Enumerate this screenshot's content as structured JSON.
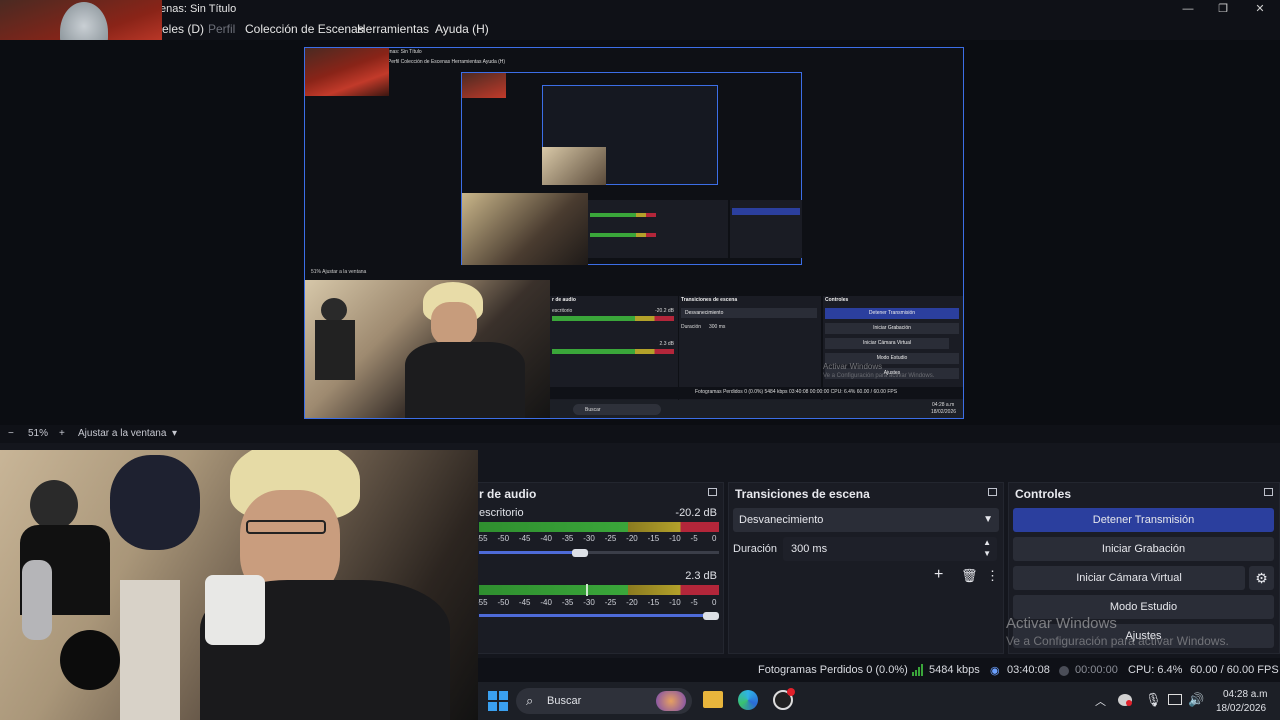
{
  "window": {
    "title": "enas: Sin Título",
    "minimize_glyph": "—",
    "maximize_glyph": "❐",
    "close_glyph": "✕"
  },
  "menu": [
    {
      "label": "eles (D)",
      "enabled": true
    },
    {
      "label": "Perfil",
      "enabled": false
    },
    {
      "label": "Colección de Escenas",
      "enabled": true
    },
    {
      "label": "Herramientas",
      "enabled": true
    },
    {
      "label": "Ayuda (H)",
      "enabled": true
    }
  ],
  "zoom": {
    "minus": "−",
    "value": "51%",
    "plus": "+",
    "fit_label": "Ajustar a la ventana",
    "dropdown_glyph": "▾"
  },
  "audio_mixer": {
    "title": "r de audio",
    "channels": [
      {
        "name": "escritorio",
        "db": "-20.2 dB",
        "volume": 0.5
      },
      {
        "name": "",
        "db": "2.3 dB",
        "volume": 1.0
      }
    ],
    "scale": [
      "-55",
      "-50",
      "-45",
      "-40",
      "-35",
      "-30",
      "-25",
      "-20",
      "-15",
      "-10",
      "-5",
      "0"
    ]
  },
  "transitions": {
    "title": "Transiciones de escena",
    "selected": "Desvanecimiento",
    "duration_label": "Duración",
    "duration_value": "300 ms",
    "add_glyph": "+",
    "delete_glyph": "🗑",
    "more_glyph": "⋮"
  },
  "controls": {
    "title": "Controles",
    "buttons": [
      {
        "label": "Detener Transmisión",
        "active": true
      },
      {
        "label": "Iniciar Grabación",
        "active": false
      },
      {
        "label": "Iniciar Cámara Virtual",
        "active": false
      },
      {
        "label": "Modo Estudio",
        "active": false
      },
      {
        "label": "Ajustes",
        "active": false
      }
    ],
    "gear_glyph": "⚙"
  },
  "watermark": {
    "line1": "Activar Windows",
    "line2": "Ve a Configuración para activar Windows."
  },
  "status": {
    "dropped_frames": "Fotogramas Perdidos 0 (0.0%)",
    "bitrate": "5484 kbps",
    "stream_time": "03:40:08",
    "record_time": "00:00:00",
    "cpu": "CPU: 6.4%",
    "fps": "60.00 / 60.00 FPS"
  },
  "taskbar": {
    "search_placeholder": "Buscar",
    "time": "04:28 a.m",
    "date": "18/02/2026"
  },
  "nested_preview": {
    "title": "enas: Sin Título",
    "menu": "eles (D)   Perfil   Colección de Escenas   Herramientas   Ayuda (H)",
    "zoom": "51%   Ajustar a la ventana",
    "mixer_title": "r de audio",
    "channel_name": "escritorio",
    "db1": "-20.2 dB",
    "db2": "2.3 dB",
    "trans_title": "Transiciones de escena",
    "trans_selected": "Desvanecimiento",
    "duration_label": "Duración",
    "duration_value": "300 ms",
    "controls_title": "Controles",
    "btn1": "Detener Transmisión",
    "btn2": "Iniciar Grabación",
    "btn3": "Iniciar Cámara Virtual",
    "btn4": "Modo Estudio",
    "btn5": "Ajustes",
    "watermark1": "Activar Windows",
    "watermark2": "Ve a Configuración para activar Windows.",
    "status_text": "Fotogramas Perdidos 0 (0.0%)   5484 kbps   03:40:08   00:00:00   CPU: 6.4%   60.00 / 60.00 FPS",
    "search": "Buscar",
    "time": "04:28 a.m",
    "date": "18/02/2026"
  },
  "colors": {
    "accent": "#2b3f9e",
    "preview_border": "#3c6ee6",
    "meter_green": "#3aa63a",
    "meter_yellow": "#b3a12a",
    "meter_red": "#b3263a"
  }
}
